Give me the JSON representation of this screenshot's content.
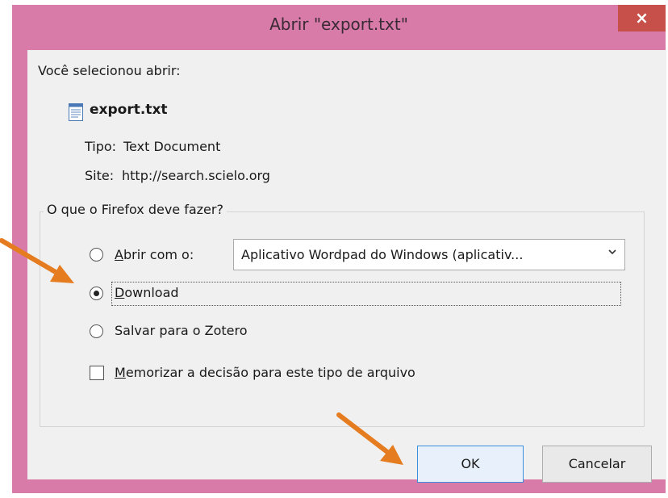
{
  "window": {
    "title": "Abrir \"export.txt\"",
    "close_glyph": "×",
    "frame_color": "#d87ba9",
    "close_color": "#c7504b"
  },
  "dialog": {
    "intro": "Você selecionou abrir:",
    "file": {
      "name": "export.txt",
      "icon": "text-file-icon"
    },
    "type_label": "Tipo:",
    "type_value": "Text Document",
    "site_label": "Site:",
    "site_value": "http://search.scielo.org"
  },
  "options": {
    "group_label": "O que o Firefox deve fazer?",
    "open_with_label": "Abrir com o:",
    "open_with_app": "Aplicativo Wordpad do Windows (aplicativ...",
    "download_label": "Download",
    "zotero_label": "Salvar para o Zotero",
    "remember_label": "Memorizar a decisão para este tipo de arquivo",
    "selected": "download",
    "remember_checked": false
  },
  "buttons": {
    "ok": "OK",
    "cancel": "Cancelar"
  },
  "annotations": {
    "arrow_color": "#e57c20"
  }
}
